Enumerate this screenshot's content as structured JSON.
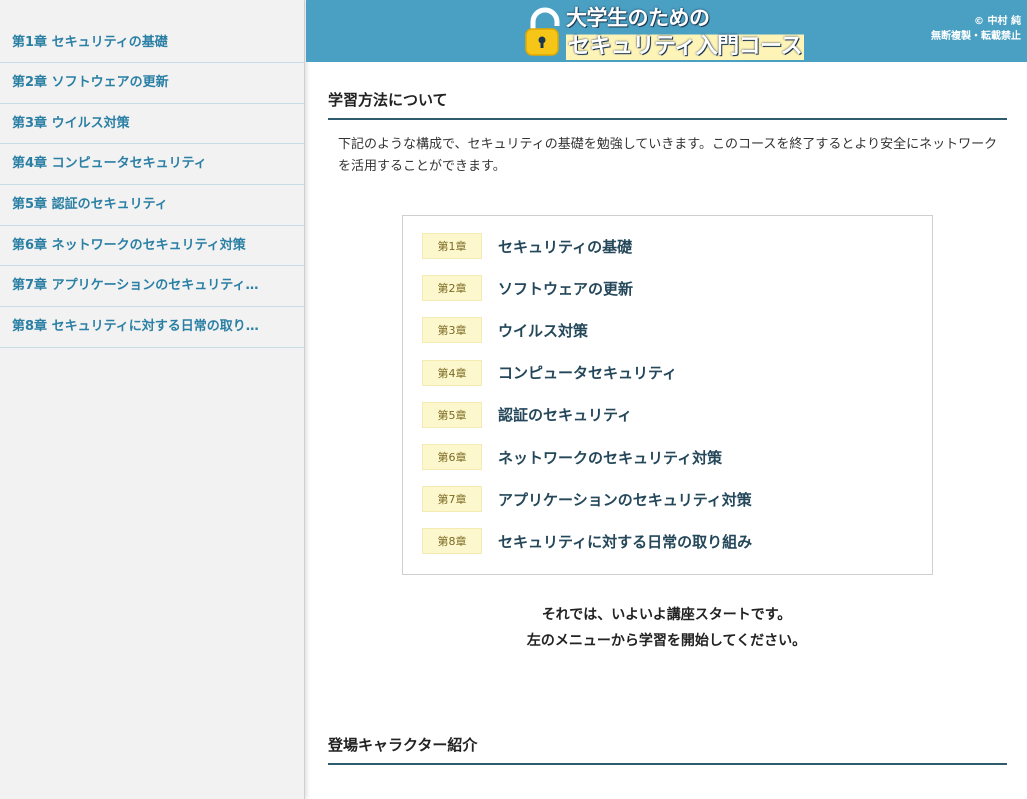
{
  "sidebar": {
    "items": [
      {
        "label": "第1章 セキュリティの基礎"
      },
      {
        "label": "第2章 ソフトウェアの更新"
      },
      {
        "label": "第3章 ウイルス対策"
      },
      {
        "label": "第4章 コンピュータセキュリティ"
      },
      {
        "label": "第5章 認証のセキュリティ"
      },
      {
        "label": "第6章 ネットワークのセキュリティ対策"
      },
      {
        "label": "第7章 アプリケーションのセキュリティ…"
      },
      {
        "label": "第8章 セキュリティに対する日常の取り…"
      }
    ]
  },
  "header": {
    "logo_line1": "大学生のための",
    "logo_line2": "セキュリティ入門コース",
    "logo_icon": "lock-icon",
    "copyright_line1": "© 中村 純",
    "copyright_line2": "無断複製・転載禁止"
  },
  "main": {
    "section1_title": "学習方法について",
    "intro": "下記のような構成で、セキュリティの基礎を勉強していきます。このコースを終了するとより安全にネットワークを活用することができます。",
    "toc": [
      {
        "badge": "第1章",
        "title": "セキュリティの基礎"
      },
      {
        "badge": "第2章",
        "title": "ソフトウェアの更新"
      },
      {
        "badge": "第3章",
        "title": "ウイルス対策"
      },
      {
        "badge": "第4章",
        "title": "コンピュータセキュリティ"
      },
      {
        "badge": "第5章",
        "title": "認証のセキュリティ"
      },
      {
        "badge": "第6章",
        "title": "ネットワークのセキュリティ対策"
      },
      {
        "badge": "第7章",
        "title": "アプリケーションのセキュリティ対策"
      },
      {
        "badge": "第8章",
        "title": "セキュリティに対する日常の取り組み"
      }
    ],
    "start_line1": "それでは、いよいよ講座スタートです。",
    "start_line2": "左のメニューから学習を開始してください。",
    "section2_title": "登場キャラクター紹介"
  },
  "colors": {
    "header_bg": "#4aa0c2",
    "sidebar_link": "#2a7fa4",
    "badge_bg": "#fdf7cd",
    "title_underline": "#2f5b6e"
  }
}
